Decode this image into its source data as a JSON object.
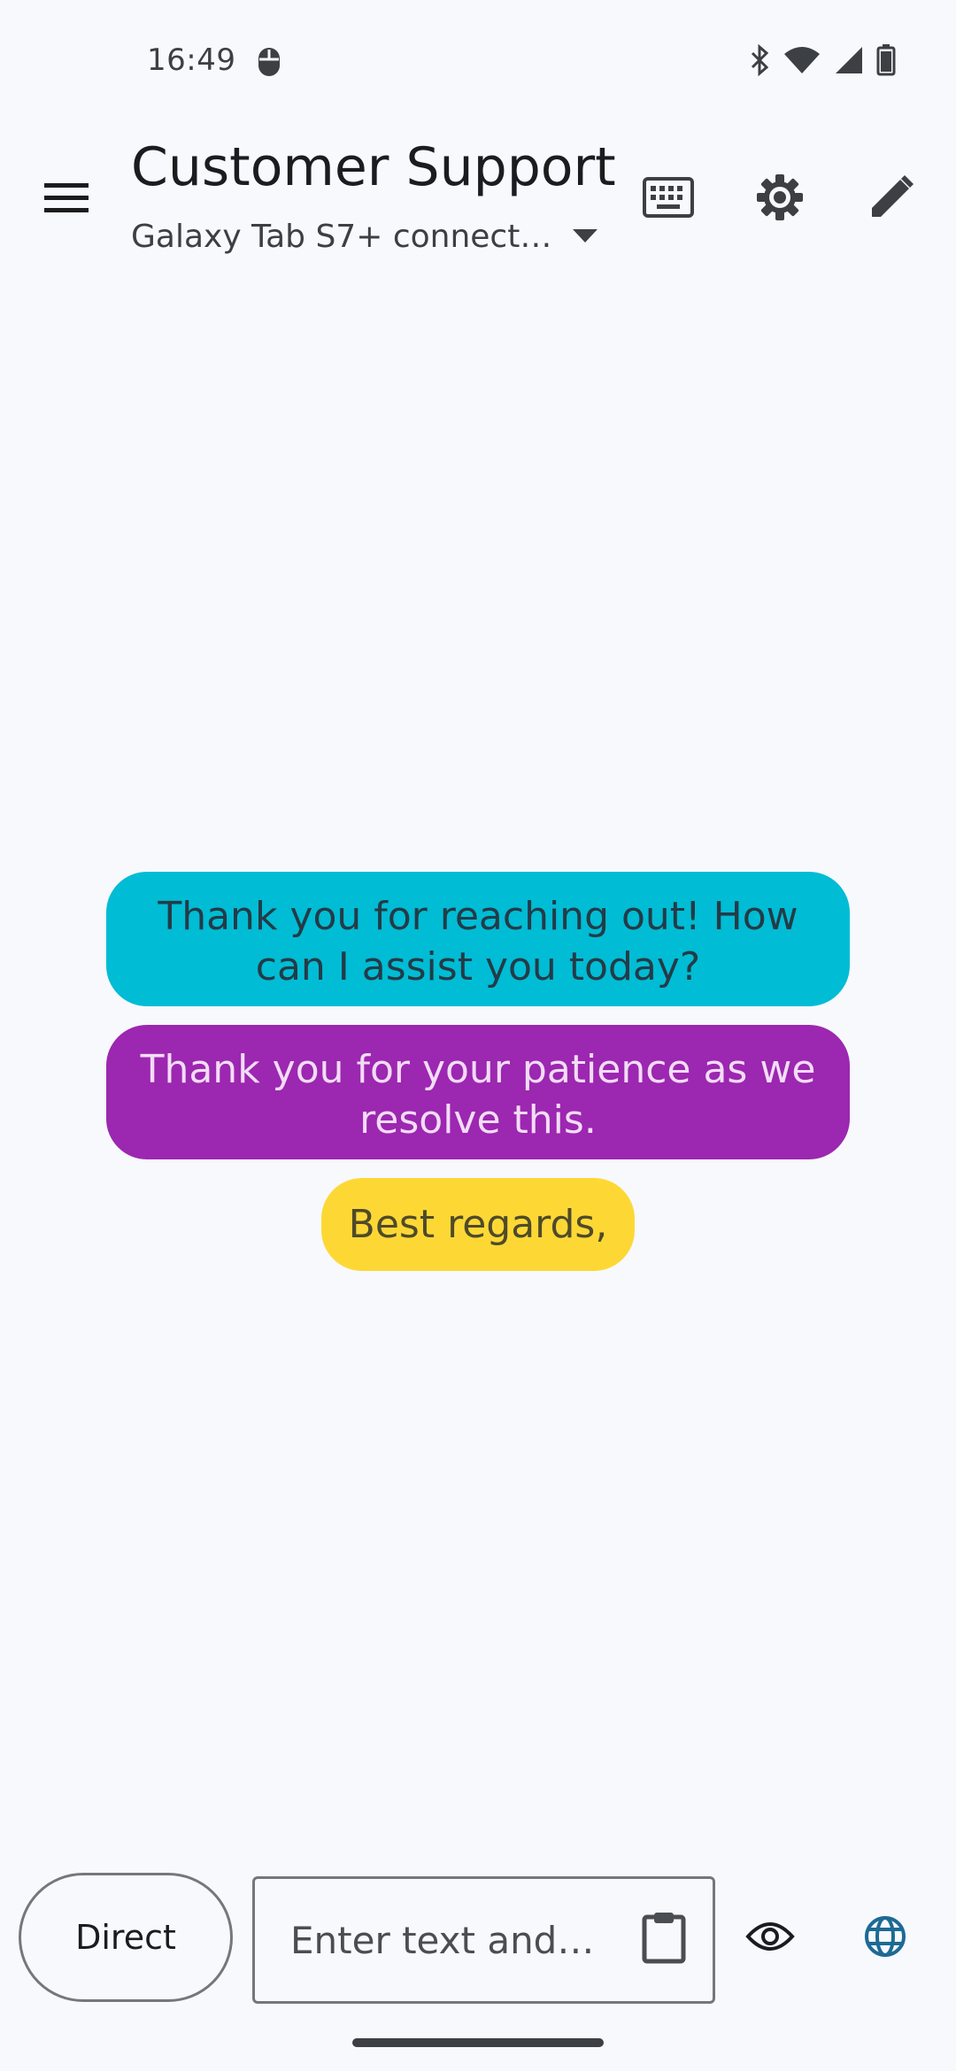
{
  "status_bar": {
    "time": "16:49",
    "icons": [
      "mouse-icon",
      "bluetooth-icon",
      "wifi-icon",
      "signal-icon",
      "battery-icon"
    ]
  },
  "app_bar": {
    "title": "Customer Support",
    "device": "Galaxy Tab S7+ connect…",
    "icons": [
      "menu-icon",
      "keyboard-icon",
      "gear-icon",
      "pencil-icon",
      "chevron-down-icon"
    ]
  },
  "messages": [
    {
      "text": "Thank you for reaching out! How can I assist you today?",
      "color": "#00bcd4"
    },
    {
      "text": "Thank you for your patience as we resolve this.",
      "color": "#9c27b0"
    },
    {
      "text": "Best regards,",
      "color": "#fdd835"
    }
  ],
  "bottom_bar": {
    "direct_label": "Direct",
    "input_placeholder": "Enter text and…",
    "input_value": "",
    "icons": [
      "clipboard-icon",
      "eye-icon",
      "globe-icon"
    ]
  },
  "colors": {
    "background": "#f7f9fd",
    "accent_globe": "#1d6a94"
  }
}
